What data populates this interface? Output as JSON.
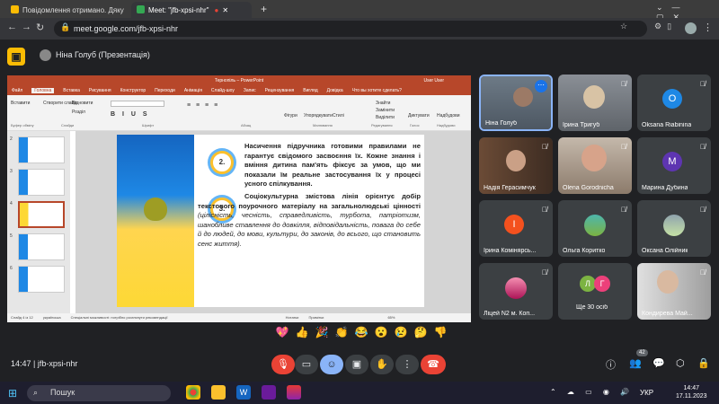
{
  "browser": {
    "tabs": [
      {
        "title": "Повідомлення отримано. Дяку",
        "active": false
      },
      {
        "title": "Meet: \"jfb-xpsi-nhr\"",
        "active": true
      }
    ],
    "new_tab": "+",
    "url": "meet.google.com/jfb-xpsi-nhr"
  },
  "meet": {
    "presenter_label": "Ніна Голуб (Презентація)",
    "time": "14:47",
    "meeting_code": "jfb-xpsi-nhr",
    "participant_count": "42",
    "reactions": [
      "💖",
      "👍",
      "🎉",
      "👏",
      "😂",
      "😮",
      "😢",
      "🤔",
      "👎"
    ]
  },
  "ppt": {
    "window_title": "Тернопіль – PowerPoint",
    "user": "User User",
    "ribbon_tabs": [
      "Файл",
      "Головна",
      "Вставка",
      "Рисування",
      "Конструктор",
      "Переходи",
      "Анімація",
      "Слайд-шоу",
      "Запис",
      "Рецензування",
      "Вигляд",
      "Довідка"
    ],
    "tell_me": "Что вы хотите сделать?",
    "ribbon_groups": [
      "Буфер обміну",
      "Слайди",
      "Шрифт",
      "Абзац",
      "Малювання",
      "Редагування",
      "Голос",
      "Надбудови"
    ],
    "ribbon_buttons": {
      "insert": "Вставити",
      "new_slide": "Створити слайд",
      "reset": "Відновити",
      "section": "Розділ",
      "shapes": "Фігури",
      "arrange": "Упорядкувати",
      "styles": "Стилі",
      "find": "Знайти",
      "replace": "Замінити",
      "select": "Виділити",
      "dictate": "Диктувати",
      "addins": "Надбудови"
    },
    "slide_numbers": [
      "2",
      "3",
      "4",
      "5",
      "6"
    ],
    "status_left": "Слайд 4 із 12",
    "status_lang": "українська",
    "status_access": "Спеціальні можливості: потрібно розглянути рекомендації",
    "status_notes": "Нотатки",
    "status_comments": "Примітки",
    "zoom": "65%",
    "slide": {
      "bullet2": "2.",
      "bullet3": "3.",
      "para1": "Насичення підручника готовими правилами не гарантує свідомого засвоєння їх. Кожне знання і вміння дитина пам'ять фіксує за умов, що ми показали їм реальне застосування їх у процесі усного спілкування.",
      "para2_bold": "Соціокультурна змістова лінія орієнтує добір текстового поурочного матеріалу на загальнолюдські цінності",
      "para2_italic": "(цілісність, чесність, справедливість, турбота, патріотизм, шанобливе ставлення до довкілля, відповідальність, повага до себе й до людей, до мови, культури, до законів, до всього, що становить сенс життя)."
    }
  },
  "participants": [
    {
      "name": "Ніна Голуб",
      "type": "photo",
      "muted": false,
      "more": true
    },
    {
      "name": "Ірина Тригуб",
      "type": "photo",
      "muted": true
    },
    {
      "name": "Oksana Riabinina",
      "type": "avatar",
      "initial": "O",
      "color": "#1e88e5",
      "muted": true
    },
    {
      "name": "Надія Герасимчук",
      "type": "photo",
      "muted": true
    },
    {
      "name": "Olena Gorodnicha",
      "type": "photo",
      "muted": true
    },
    {
      "name": "Марина Дубина",
      "type": "avatar",
      "initial": "М",
      "color": "#5e35b1",
      "muted": true
    },
    {
      "name": "Ірина Комінярсь...",
      "type": "avatar",
      "initial": "І",
      "color": "#f4511e",
      "muted": true
    },
    {
      "name": "Ольга Коритко",
      "type": "photo",
      "muted": true
    },
    {
      "name": "Оксана Олійник",
      "type": "photo",
      "muted": true
    },
    {
      "name": "Ліцей N2 м. Коп...",
      "type": "photo",
      "muted": true
    },
    {
      "name": "Ще 30 осіб",
      "type": "group",
      "initials": [
        "Л",
        "Г"
      ],
      "muted": false
    },
    {
      "name": "Кондирева Май...",
      "type": "photo",
      "muted": true
    }
  ],
  "taskbar": {
    "search": "Пошук",
    "language": "УКР",
    "time": "14:47",
    "date": "17.11.2023"
  },
  "colors": {
    "accent": "#b7472a",
    "end_call": "#ea4335",
    "present": "#fbbc04"
  }
}
